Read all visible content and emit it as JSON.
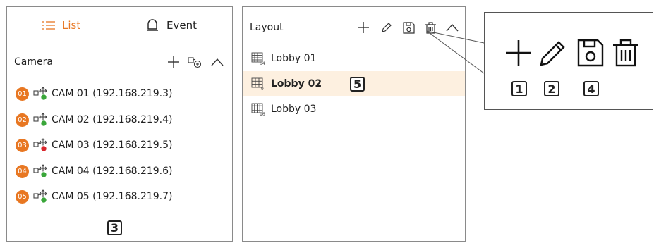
{
  "left_panel": {
    "tabs": [
      {
        "label": "List",
        "icon": "list-icon",
        "active": true
      },
      {
        "label": "Event",
        "icon": "bell-icon",
        "active": false
      }
    ],
    "camera_section": {
      "title": "Camera",
      "icons": [
        "plus-icon",
        "add-camera-icon",
        "chevron-up-icon"
      ]
    },
    "cameras": [
      {
        "num": "01",
        "label": "CAM 01 (192.168.219.3)",
        "status": "green"
      },
      {
        "num": "02",
        "label": "CAM 02 (192.168.219.4)",
        "status": "green"
      },
      {
        "num": "03",
        "label": "CAM 03 (192.168.219.5)",
        "status": "red"
      },
      {
        "num": "04",
        "label": "CAM 04 (192.168.219.6)",
        "status": "green"
      },
      {
        "num": "05",
        "label": "CAM 05 (192.168.219.7)",
        "status": "green"
      }
    ],
    "callout": "3"
  },
  "mid_panel": {
    "title": "Layout",
    "icons": [
      "plus-icon",
      "pencil-icon",
      "save-icon",
      "trash-icon",
      "chevron-up-icon"
    ],
    "layouts": [
      {
        "label": "Lobby 01",
        "icon": "layout-64-icon",
        "selected": false
      },
      {
        "label": "Lobby 02",
        "icon": "layout-9-icon",
        "selected": true
      },
      {
        "label": "Lobby 03",
        "icon": "layout-16-icon",
        "selected": false
      }
    ],
    "callout": "5"
  },
  "zoom_callout": {
    "icons": [
      "plus-icon",
      "pencil-icon",
      "save-icon",
      "trash-icon"
    ],
    "labels": [
      "1",
      "2",
      "4"
    ]
  },
  "colors": {
    "accent": "#e87722",
    "selected_row": "#fdf0e0",
    "status_green": "#3aa63a",
    "status_red": "#d9262c",
    "border": "#8a8a8a"
  }
}
